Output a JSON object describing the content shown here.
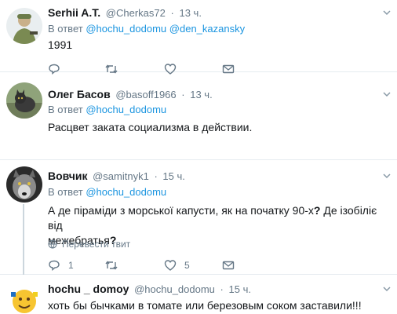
{
  "tweets": [
    {
      "name": "Serhii A.T.",
      "handle": "@Cherkas72",
      "dot": "·",
      "time": "13 ч.",
      "reply_prefix": "В ответ",
      "mentions": [
        "@hochu_dodomu",
        "@den_kazansky"
      ],
      "text": "1991",
      "counts": {
        "reply": "",
        "retweet": "",
        "like": ""
      }
    },
    {
      "name": "Олег Басов",
      "handle": "@basoff1966",
      "dot": "·",
      "time": "13 ч.",
      "reply_prefix": "В ответ",
      "mentions": [
        "@hochu_dodomu"
      ],
      "text": "Расцвет заката социализма в действии.",
      "counts": {
        "reply": "",
        "retweet": "",
        "like": ""
      }
    },
    {
      "name": "Вовчик",
      "handle": "@samitnyk1",
      "dot": "·",
      "time": "15 ч.",
      "reply_prefix": "В ответ",
      "mentions": [
        "@hochu_dodomu"
      ],
      "text_line1": "А де піраміди з морської капусти, як на початку 90-х",
      "text_q1": "?",
      "text_line1b": " Де ізобіліє від",
      "text_line2": "межебратья",
      "text_q2": "?",
      "translate": "Перевести твит",
      "counts": {
        "reply": "1",
        "retweet": "",
        "like": "5"
      }
    },
    {
      "name": "hochu _ domoy",
      "handle": "@hochu_dodomu",
      "dot": "·",
      "time": "15 ч.",
      "text": "хоть бы бычками  в томате или березовым соком заставили!!!"
    }
  ],
  "colors": {
    "link": "#1b95e0",
    "secondary": "#657786",
    "question_mark": "#14171a",
    "divider": "#e6ecf0"
  },
  "icons": {
    "caret": "chevron-down-icon",
    "reply": "reply-icon",
    "retweet": "retweet-icon",
    "like": "heart-icon",
    "dm": "envelope-icon",
    "translate": "globe-icon"
  }
}
